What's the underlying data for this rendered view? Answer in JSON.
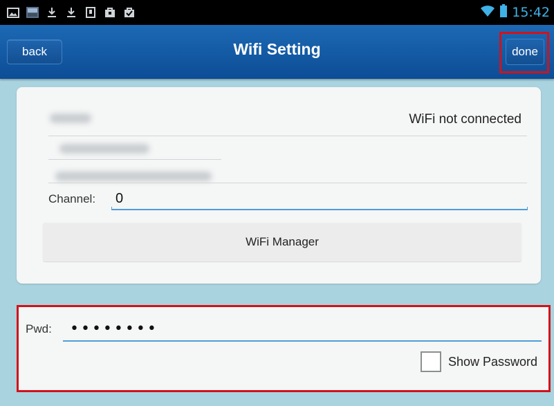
{
  "status_bar": {
    "left_icons": [
      "image-icon",
      "photo-icon",
      "download-icon",
      "download-icon",
      "sd-card-icon",
      "bag-icon",
      "bag-check-icon"
    ],
    "time": "15:42"
  },
  "nav": {
    "back_label": "back",
    "title": "Wifi Setting",
    "done_label": "done"
  },
  "wifi_card": {
    "status_text": "WiFi not connected",
    "channel_label": "Channel:",
    "channel_value": "0",
    "manager_label": "WiFi Manager"
  },
  "password": {
    "label": "Pwd:",
    "value": "••••••••",
    "show_password_label": "Show Password",
    "show_password_checked": false
  },
  "colors": {
    "nav_bar": "#1d69b4",
    "highlight": "#d2121b",
    "accent": "#4c9ed9",
    "background": "#a9d3de",
    "time": "#3fb1e6"
  }
}
